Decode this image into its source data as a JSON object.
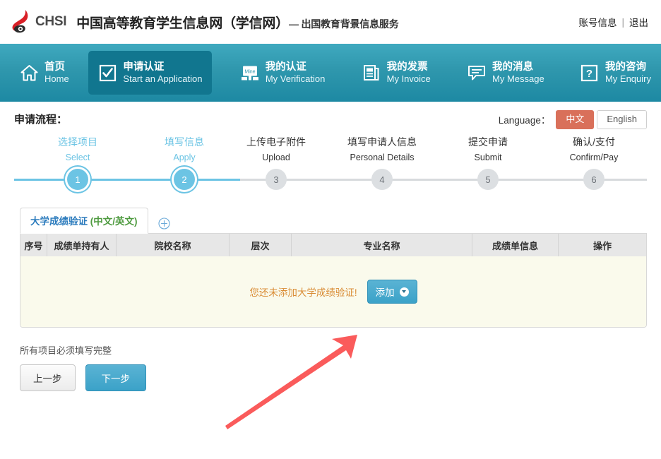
{
  "header": {
    "logo_text": "CHSI",
    "logo_icon": "chsi-bird-logo",
    "site_title": "中国高等教育学生信息网（学信网）",
    "site_subtitle": "— 出国教育背景信息服务",
    "account_link": "账号信息",
    "separator": "|",
    "logout_link": "退出"
  },
  "nav": {
    "items": [
      {
        "cn": "首页",
        "en": "Home",
        "icon": "home-icon",
        "active": false
      },
      {
        "cn": "申请认证",
        "en": "Start an Application",
        "icon": "checkbox-check-icon",
        "active": true
      },
      {
        "cn": "我的认证",
        "en": "My Verification",
        "icon": "mine-card-icon",
        "active": false
      },
      {
        "cn": "我的发票",
        "en": "My Invoice",
        "icon": "invoice-document-icon",
        "active": false
      },
      {
        "cn": "我的消息",
        "en": "My Message",
        "icon": "message-bubble-icon",
        "active": false
      },
      {
        "cn": "我的咨询",
        "en": "My Enquiry",
        "icon": "question-mark-icon",
        "active": false
      }
    ]
  },
  "flow": {
    "title": "申请流程：",
    "language_label": "Language：",
    "lang_cn": "中文",
    "lang_en": "English",
    "active_lang": "中文",
    "steps": [
      {
        "num": "1",
        "cn": "选择项目",
        "en": "Select",
        "state": "done"
      },
      {
        "num": "2",
        "cn": "填写信息",
        "en": "Apply",
        "state": "done"
      },
      {
        "num": "3",
        "cn": "上传电子附件",
        "en": "Upload",
        "state": "todo"
      },
      {
        "num": "4",
        "cn": "填写申请人信息",
        "en": "Personal Details",
        "state": "todo"
      },
      {
        "num": "5",
        "cn": "提交申请",
        "en": "Submit",
        "state": "todo"
      },
      {
        "num": "6",
        "cn": "确认/支付",
        "en": "Confirm/Pay",
        "state": "todo"
      }
    ]
  },
  "panel": {
    "tab_label_cn": "大学成绩验证",
    "tab_label_en": "(中文/英文)",
    "add_tab_icon": "plus-circle-icon",
    "columns": [
      "序号",
      "成绩单持有人",
      "院校名称",
      "层次",
      "专业名称",
      "成绩单信息",
      "操作"
    ],
    "rows": [],
    "empty_message": "您还未添加大学成绩验证!",
    "add_button_label": "添加",
    "add_button_icon": "down-arrow-circle-icon"
  },
  "footer": {
    "note": "所有项目必须填写完整",
    "prev_label": "上一步",
    "next_label": "下一步"
  },
  "annotation": {
    "type": "arrow",
    "color": "#fa5b5b",
    "points_to": "add-button"
  },
  "colors": {
    "nav_top": "#3fa9bf",
    "nav_bottom": "#1d89a3",
    "nav_active": "#11768f",
    "accent_blue": "#6cc4e4",
    "button_blue": "#3ba2c8",
    "lang_active": "#d9705a",
    "tab_cn": "#2b7bbd",
    "tab_en": "#4e9a3f",
    "empty_text": "#d98b33",
    "panel_bg": "#fafaec",
    "logo_red": "#d81f26"
  }
}
